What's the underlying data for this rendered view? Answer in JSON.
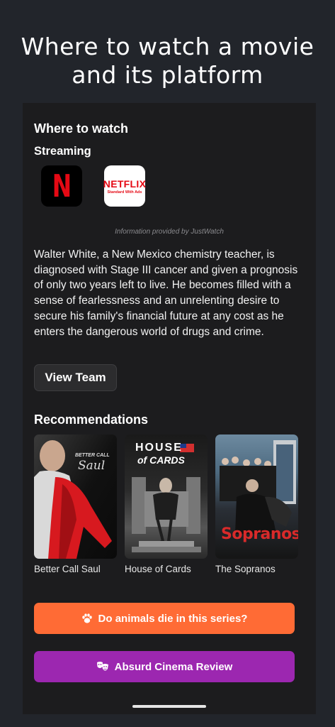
{
  "header": {
    "title_line1": "Where to watch a movie",
    "title_line2": "and its platform"
  },
  "where_to_watch": {
    "title": "Where to watch",
    "streaming_label": "Streaming",
    "providers": [
      {
        "name": "Netflix",
        "logo_text": "N",
        "icon": "netflix-icon"
      },
      {
        "name": "Netflix Standard With Ads",
        "logo_text": "NETFLIX",
        "logo_subtext": "Standard With Ads",
        "icon": "netflix-ads-icon"
      }
    ],
    "attribution": "Information provided by JustWatch"
  },
  "description": "Walter White, a New Mexico chemistry teacher, is diagnosed with Stage III cancer and given a prognosis of only two years left to live. He becomes filled with a sense of fearlessness and an unrelenting desire to secure his family's financial future at any cost as he enters the dangerous world of drugs and crime.",
  "view_team_label": "View Team",
  "recommendations": {
    "title": "Recommendations",
    "items": [
      {
        "title": "Better Call Saul",
        "poster_text_line1": "BETTER CALL",
        "poster_text_line2": "Saul"
      },
      {
        "title": "House of Cards",
        "poster_text_line1": "HOUSE",
        "poster_text_line2": "of CARDS"
      },
      {
        "title": "The Sopranos",
        "poster_text_line1": "Sopranos"
      }
    ]
  },
  "actions": {
    "animals_label": "Do animals die in this series?",
    "animals_icon": "paw-icon",
    "animals_color": "#ff6b35",
    "absurd_label": "Absurd Cinema Review",
    "absurd_icon": "theater-masks-icon",
    "absurd_color": "#9c27b0"
  },
  "colors": {
    "netflix_red": "#e50914",
    "background": "#22252b",
    "card": "#1c1c1e"
  }
}
